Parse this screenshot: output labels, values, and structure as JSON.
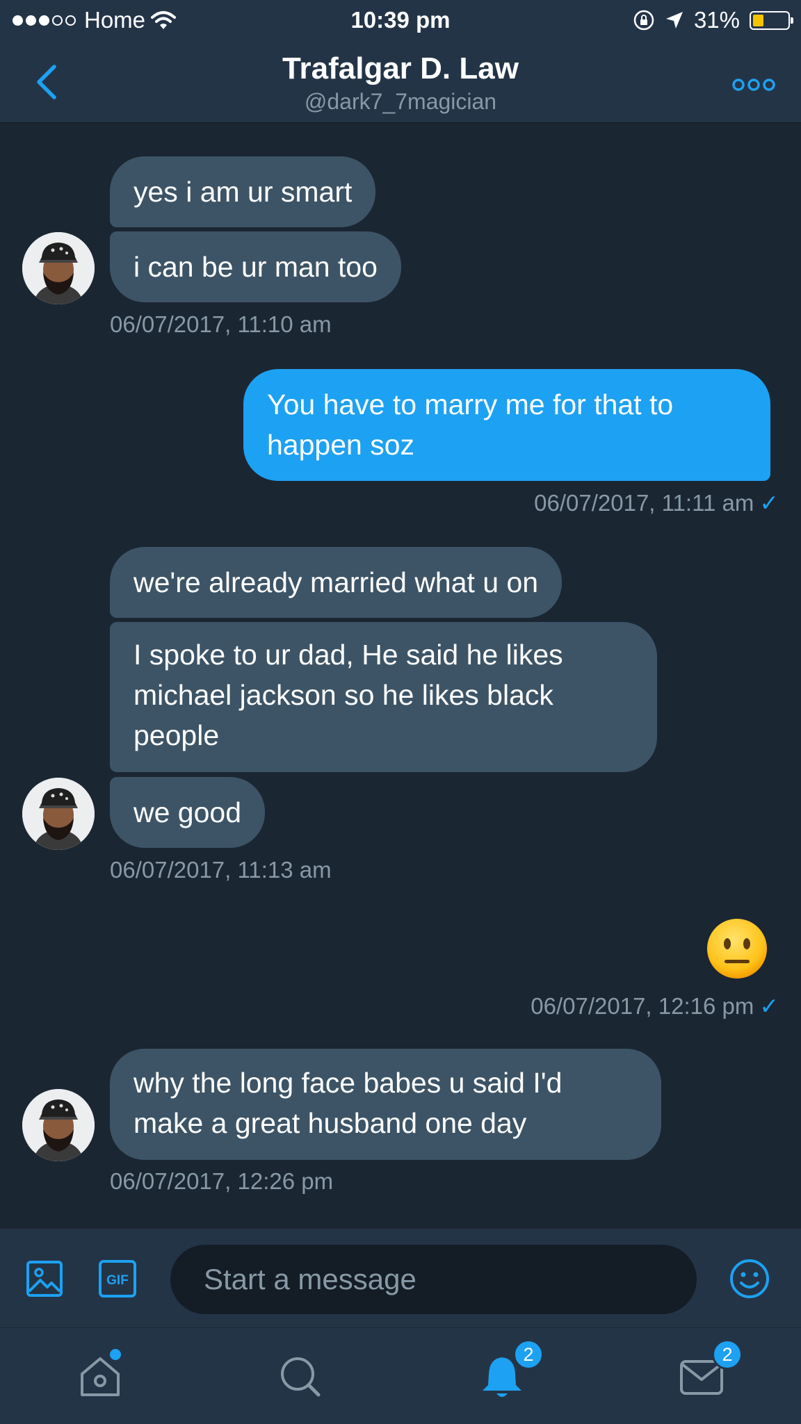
{
  "status_bar": {
    "carrier": "Home",
    "time": "10:39 pm",
    "battery_percent": "31%",
    "battery_level": 0.31,
    "signal_bars_filled": 3,
    "signal_bars_total": 5
  },
  "header": {
    "name": "Trafalgar D. Law",
    "handle": "@dark7_7magician"
  },
  "messages": [
    {
      "direction": "incoming",
      "text": "yes i am ur smart"
    },
    {
      "direction": "incoming",
      "text": "i can be ur man too"
    },
    {
      "direction": "incoming",
      "timestamp": "06/07/2017, 11:10 am"
    },
    {
      "direction": "outgoing",
      "text": "You have to marry me for that to happen soz",
      "timestamp": "06/07/2017, 11:11 am"
    },
    {
      "direction": "incoming",
      "text": "we're already married what u on"
    },
    {
      "direction": "incoming",
      "text": "I spoke to ur dad, He said he likes michael jackson so he likes black people"
    },
    {
      "direction": "incoming",
      "text": "we good",
      "timestamp": "06/07/2017, 11:13 am"
    },
    {
      "direction": "outgoing",
      "emoji": "neutral-face",
      "timestamp": "06/07/2017, 12:16 pm"
    },
    {
      "direction": "incoming",
      "text": "why the long face babes u said I'd make a great husband one day",
      "timestamp": "06/07/2017, 12:26 pm"
    }
  ],
  "composer": {
    "placeholder": "Start a message",
    "gif_label": "GIF"
  },
  "tabs": {
    "notifications_badge": "2",
    "messages_badge": "2"
  },
  "colors": {
    "accent": "#1da1f2",
    "background": "#1b2633",
    "bar": "#243447",
    "incoming_bubble": "#3d5466",
    "muted_text": "#8899a6"
  }
}
